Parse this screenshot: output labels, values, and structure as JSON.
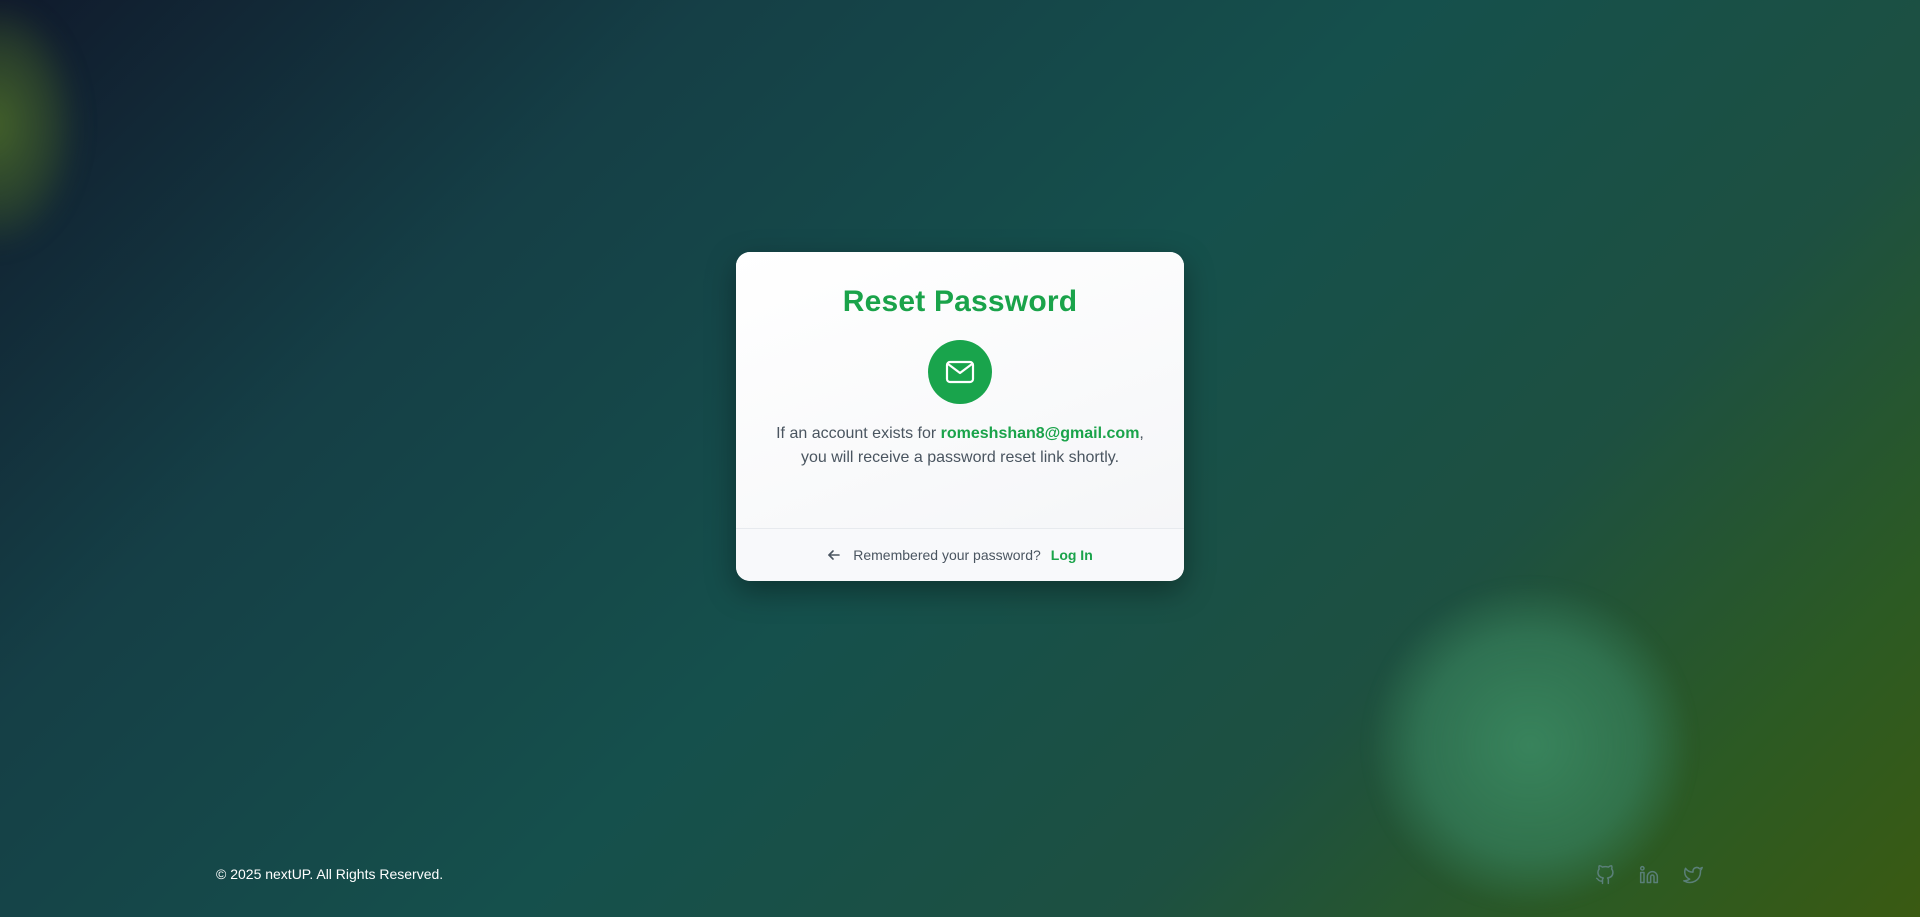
{
  "card": {
    "title": "Reset Password",
    "message_prefix": "If an account exists for ",
    "email": "romeshshan8@gmail.com",
    "message_suffix": ",",
    "message_line2": "you will receive a password reset link shortly.",
    "footer_text": "Remembered your password?",
    "login_label": "Log In"
  },
  "footer": {
    "copyright": "© 2025 nextUP. All Rights Reserved."
  },
  "icons": {
    "mail": "mail-icon",
    "back": "arrow-left-icon",
    "social": [
      "github-icon",
      "linkedin-icon",
      "twitter-icon"
    ]
  },
  "colors": {
    "accent": "#1aa34a",
    "mail_circle": "#19a44c",
    "text": "#4a5560",
    "social_icon": "#5a7f78"
  }
}
